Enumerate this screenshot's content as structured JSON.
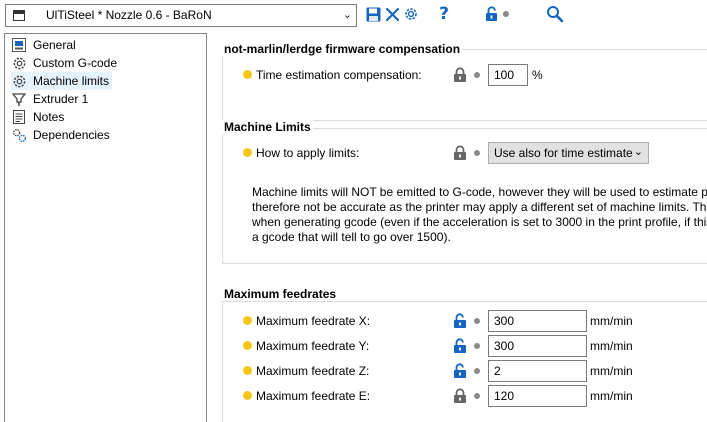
{
  "toolbar": {
    "preset_name": "UlTiSteel * Nozzle 0.6 - BaRoN",
    "icons": [
      "save-icon",
      "delete-icon",
      "settings-icon",
      "help-icon",
      "unlock-icon",
      "search-icon"
    ],
    "colors": {
      "accent_blue": "#1565c0",
      "yellow_dot": "#f5c518"
    }
  },
  "tree": {
    "items": [
      {
        "label": "General",
        "icon": "printer-icon"
      },
      {
        "label": "Custom G-code",
        "icon": "gear-icon"
      },
      {
        "label": "Machine limits",
        "icon": "gear-icon",
        "selected": true
      },
      {
        "label": "Extruder 1",
        "icon": "extruder-icon"
      },
      {
        "label": "Notes",
        "icon": "notes-icon"
      },
      {
        "label": "Dependencies",
        "icon": "dependencies-icon"
      }
    ]
  },
  "sections": {
    "compensation": {
      "title": "not-marlin/lerdge firmware compensation",
      "label": "Time estimation compensation:",
      "value": "100",
      "unit": "%",
      "locked": true
    },
    "limits": {
      "title": "Machine Limits",
      "label": "How to apply limits:",
      "selected": "Use also for time estimate",
      "locked": true,
      "note_lines": [
        "Machine limits will NOT be emitted to G-code, however they will be used to estimate prir",
        "therefore not be accurate as the printer may apply a different set of machine limits. They",
        "when generating gcode (even if the acceleration is set to 3000 in the print profile, if this is",
        "a gcode that will tell to go over 1500)."
      ]
    },
    "feedrates": {
      "title": "Maximum feedrates",
      "rows": [
        {
          "label": "Maximum feedrate X:",
          "value": "300",
          "unit": "mm/min",
          "locked": false
        },
        {
          "label": "Maximum feedrate Y:",
          "value": "300",
          "unit": "mm/min",
          "locked": false
        },
        {
          "label": "Maximum feedrate Z:",
          "value": "2",
          "unit": "mm/min",
          "locked": false
        },
        {
          "label": "Maximum feedrate E:",
          "value": "120",
          "unit": "mm/min",
          "locked": true
        }
      ]
    }
  }
}
